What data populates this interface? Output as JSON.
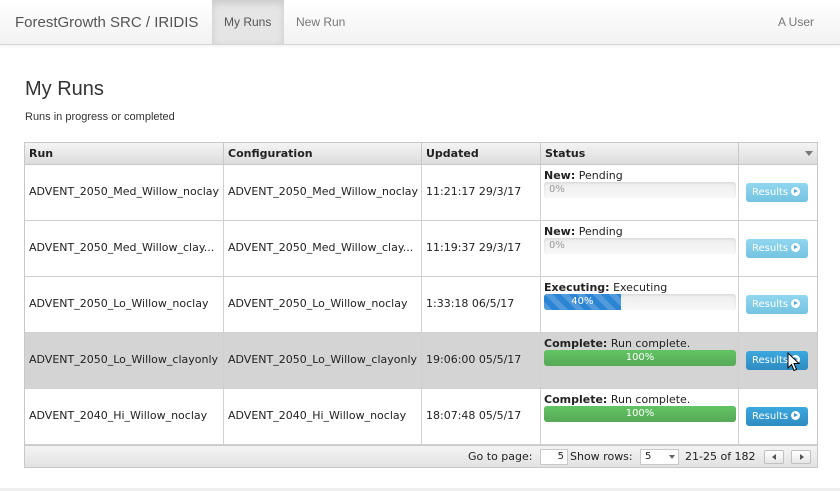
{
  "navbar": {
    "brand": "ForestGrowth SRC / IRIDIS",
    "links": [
      {
        "label": "My Runs",
        "active": true
      },
      {
        "label": "New Run",
        "active": false
      }
    ],
    "user": "A User"
  },
  "page": {
    "title": "My Runs",
    "subtitle": "Runs in progress or completed"
  },
  "table": {
    "columns": [
      "Run",
      "Configuration",
      "Updated",
      "Status"
    ],
    "rows": [
      {
        "run": "ADVENT_2050_Med_Willow_noclay",
        "configuration": "ADVENT_2050_Med_Willow_noclay",
        "updated": "11:21:17 29/3/17",
        "status_label": "New:",
        "status_text": "Pending",
        "progress_text": "0%",
        "progress": 0,
        "button": "Results",
        "selected": false
      },
      {
        "run": "ADVENT_2050_Med_Willow_clay...",
        "configuration": "ADVENT_2050_Med_Willow_clay...",
        "updated": "11:19:37 29/3/17",
        "status_label": "New:",
        "status_text": "Pending",
        "progress_text": "0%",
        "progress": 0,
        "button": "Results",
        "selected": false
      },
      {
        "run": "ADVENT_2050_Lo_Willow_noclay",
        "configuration": "ADVENT_2050_Lo_Willow_noclay",
        "updated": "1:33:18 06/5/17",
        "status_label": "Executing:",
        "status_text": "Executing",
        "progress_text": "40%",
        "progress": 40,
        "button": "Results",
        "selected": false
      },
      {
        "run": "ADVENT_2050_Lo_Willow_clayonly",
        "configuration": "ADVENT_2050_Lo_Willow_clayonly",
        "updated": "19:06:00 05/5/17",
        "status_label": "Complete:",
        "status_text": "Run complete.",
        "progress_text": "100%",
        "progress": 100,
        "button": "Results",
        "selected": true
      },
      {
        "run": "ADVENT_2040_Hi_Willow_noclay",
        "configuration": "ADVENT_2040_Hi_Willow_noclay",
        "updated": "18:07:48 05/5/17",
        "status_label": "Complete:",
        "status_text": "Run complete.",
        "progress_text": "100%",
        "progress": 100,
        "button": "Results",
        "selected": false
      }
    ]
  },
  "pagination": {
    "go_to_label": "Go to page:",
    "page_value": "5",
    "show_rows_label": "Show rows:",
    "rows_value": "5",
    "range_text": "21-25 of 182"
  },
  "colors": {
    "progress_blue": "#2b84d4",
    "progress_green": "#57a957",
    "button_blue": "#2f8cc2"
  },
  "icons": [
    "results-play-icon",
    "column-menu-icon",
    "prev-page-icon",
    "next-page-icon",
    "mouse-cursor-icon"
  ]
}
